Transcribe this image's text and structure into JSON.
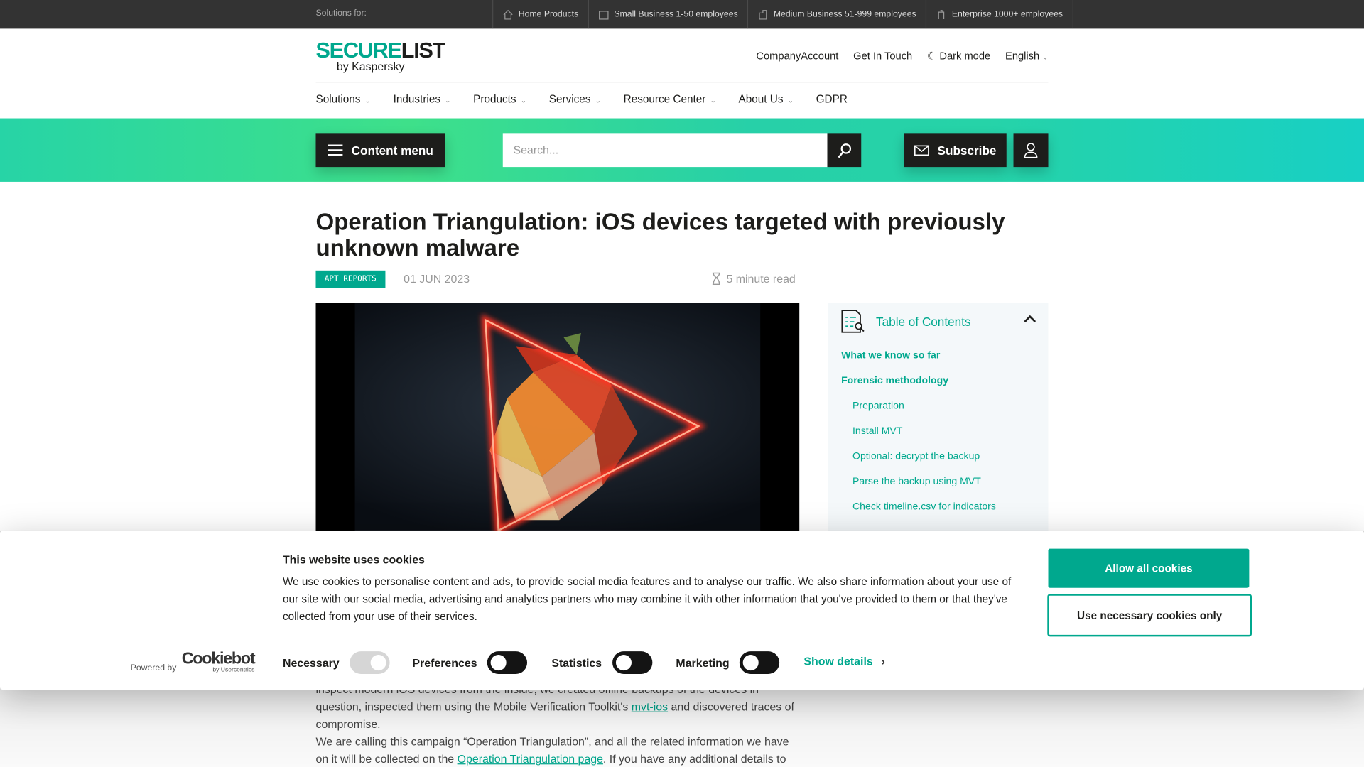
{
  "topbar": {
    "label": "Solutions for:",
    "segments": [
      {
        "label": "Home Products",
        "icon": "house-icon"
      },
      {
        "label": "Small Business 1-50 employees",
        "icon": "building-icon"
      },
      {
        "label": "Medium Business 51-999 employees",
        "icon": "office-icon"
      },
      {
        "label": "Enterprise 1000+ employees",
        "icon": "tower-icon"
      }
    ]
  },
  "logo": {
    "part1": "SECURE",
    "part2": "LIST",
    "sub": "by Kaspersky"
  },
  "header_links": {
    "company": "CompanyAccount",
    "contact": "Get In Touch",
    "dark": "Dark mode",
    "lang": "English"
  },
  "nav": [
    "Solutions",
    "Industries",
    "Products",
    "Services",
    "Resource Center",
    "About Us",
    "GDPR"
  ],
  "banner": {
    "content_menu": "Content menu",
    "search_placeholder": "Search...",
    "subscribe": "Subscribe"
  },
  "article": {
    "title": "Operation Triangulation: iOS devices targeted with previously unknown malware",
    "tag": "APT REPORTS",
    "date": "01 JUN 2023",
    "read_time": "5 minute read",
    "p1a": "inspect modern iOS devices from the inside, we created offline backups of the devices in question, inspected them using the Mobile Verification Toolkit's ",
    "p1link": "mvt-ios",
    "p1b": " and discovered traces of compromise.",
    "p2a": "We are calling this campaign “Operation Triangulation”, and all the related information we have on it will be collected on the ",
    "p2link": "Operation Triangulation page",
    "p2b": ". If you have any additional details to share,"
  },
  "toc": {
    "title": "Table of Contents",
    "items": [
      {
        "label": "What we know so far",
        "level": 1
      },
      {
        "label": "Forensic methodology",
        "level": 1
      },
      {
        "label": "Preparation",
        "level": 2
      },
      {
        "label": "Install MVT",
        "level": 2
      },
      {
        "label": "Optional: decrypt the backup",
        "level": 2
      },
      {
        "label": "Parse the backup using MVT",
        "level": 2
      },
      {
        "label": "Check timeline.csv for indicators",
        "level": 2
      }
    ]
  },
  "cookie": {
    "title": "This website uses cookies",
    "text": "We use cookies to personalise content and ads, to provide social media features and to analyse our traffic. We also share information about your use of our site with our social media, advertising and analytics partners who may combine it with other information that you've provided to them or that they've collected from your use of their services.",
    "allow": "Allow all cookies",
    "necessary_only": "Use necessary cookies only",
    "powered_by": "Powered by",
    "brand": "Cookiebot",
    "brand_sub": "by Usercentrics",
    "toggles": [
      {
        "label": "Necessary",
        "on": true,
        "disabled": true
      },
      {
        "label": "Preferences",
        "on": false
      },
      {
        "label": "Statistics",
        "on": false
      },
      {
        "label": "Marketing",
        "on": false
      }
    ],
    "show_details": "Show details"
  },
  "colors": {
    "accent": "#00a88e",
    "topbar": "#333333",
    "dark_button": "#1d1d1b"
  }
}
